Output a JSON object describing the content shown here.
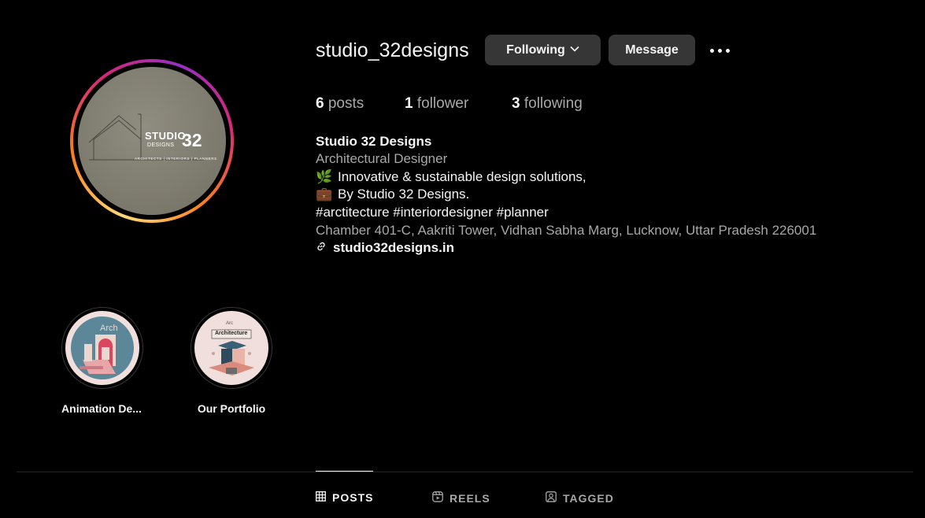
{
  "profile": {
    "username": "studio_32designs",
    "avatar": {
      "studio_text": "STUDIO",
      "designs_text": "DESIGNS",
      "number_text": "32",
      "tagline": "ARCHITECTS | INTERIORS | PLANNERS"
    },
    "buttons": {
      "following_label": "Following",
      "message_label": "Message"
    },
    "stats": {
      "posts_count": "6",
      "posts_label": "posts",
      "followers_count": "1",
      "followers_label": "follower",
      "following_count": "3",
      "following_label": "following"
    },
    "bio": {
      "name": "Studio 32 Designs",
      "category": "Architectural Designer",
      "line1_emoji": "🌿",
      "line1": "Innovative & sustainable design solutions,",
      "line2_emoji": "💼",
      "line2": "By Studio 32 Designs.",
      "hashtags": "#arctitecture #interiordesigner #planner",
      "address": "Chamber 401-C, Aakriti Tower, Vidhan Sabha Marg, Lucknow, Uttar Pradesh 226001",
      "link": "studio32designs.in"
    }
  },
  "highlights": [
    {
      "label": "Animation De...",
      "cover_text": "Arch"
    },
    {
      "label": "Our Portfolio",
      "cover_text_small": "Arc",
      "cover_text": "Architecture"
    }
  ],
  "tabs": [
    {
      "label": "POSTS",
      "icon": "grid-icon",
      "active": true
    },
    {
      "label": "REELS",
      "icon": "reels-icon",
      "active": false
    },
    {
      "label": "TAGGED",
      "icon": "tagged-icon",
      "active": false
    }
  ],
  "colors": {
    "background": "#000000",
    "button_bg": "#363636",
    "secondary_text": "#a8a8a8",
    "ring_gradient": [
      "#feda75",
      "#fa7e1e",
      "#d62976",
      "#962fbf"
    ]
  }
}
